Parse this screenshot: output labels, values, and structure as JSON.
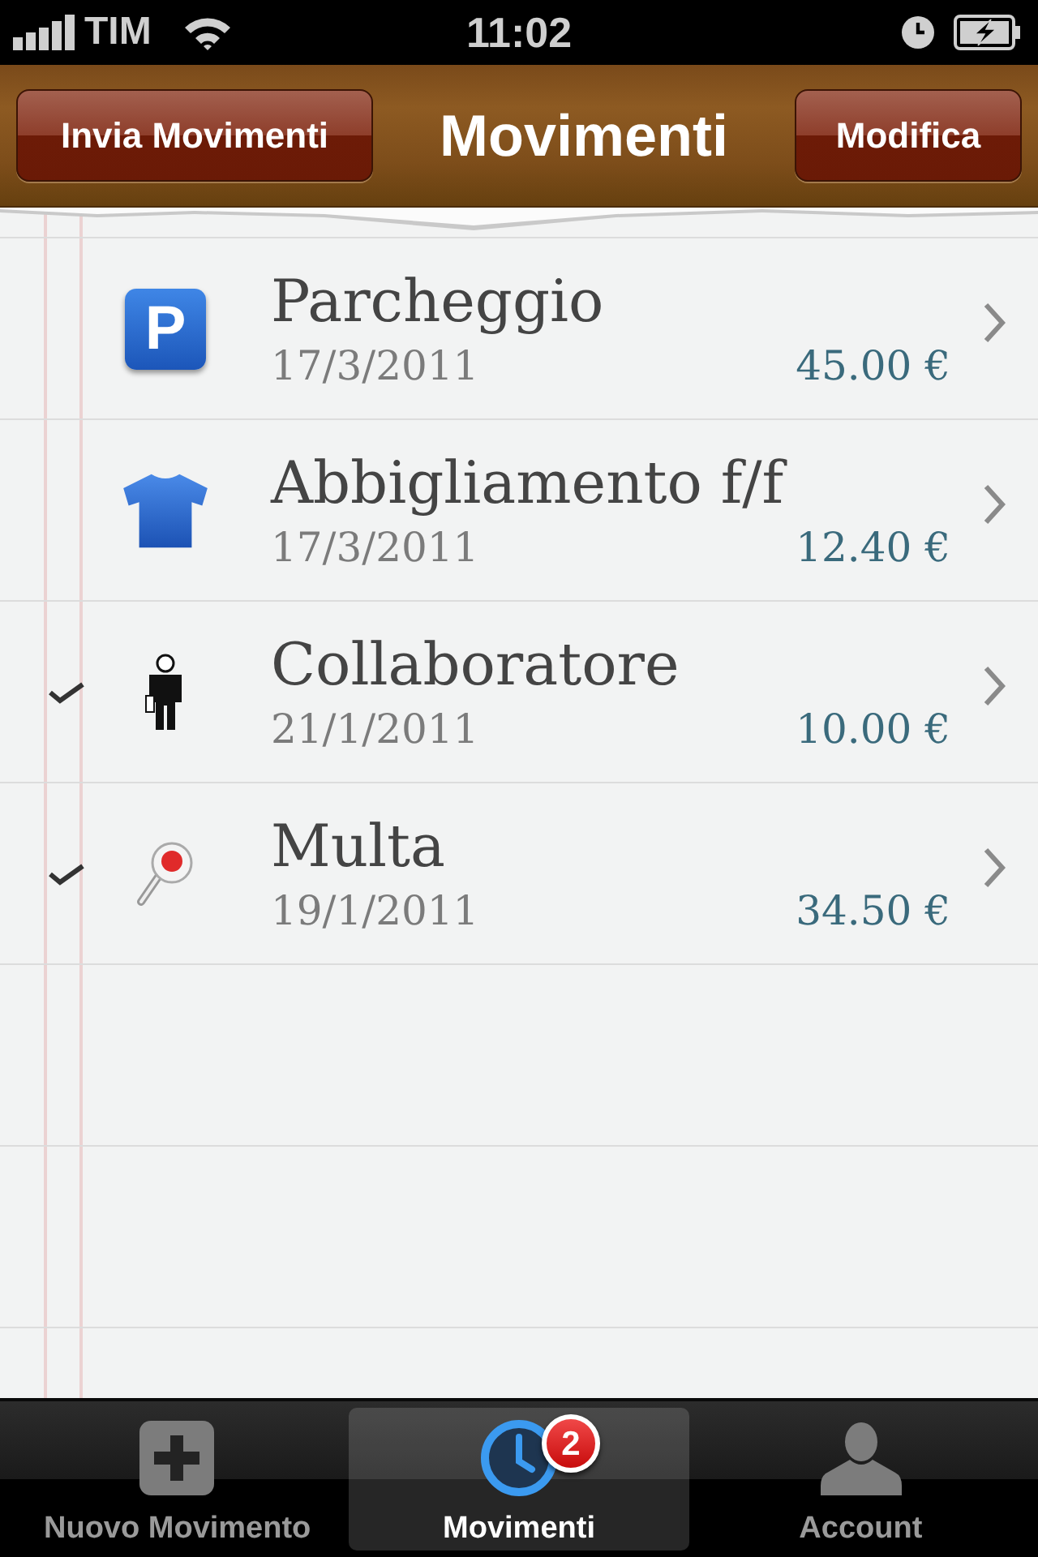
{
  "status_bar": {
    "carrier": "TIM",
    "time": "11:02"
  },
  "nav_bar": {
    "left_button": "Invia Movimenti",
    "title": "Movimenti",
    "right_button": "Modifica"
  },
  "movements": [
    {
      "kind": "parking",
      "icon_label": "P",
      "title": "Parcheggio",
      "date": "17/3/2011",
      "amount": "45.00 €",
      "checked": false
    },
    {
      "kind": "shirt",
      "title": "Abbigliamento f/f",
      "date": "17/3/2011",
      "amount": "12.40 €",
      "checked": false
    },
    {
      "kind": "person",
      "title": "Collaboratore",
      "date": "21/1/2011",
      "amount": "10.00 €",
      "checked": true
    },
    {
      "kind": "paddle",
      "title": "Multa",
      "date": "19/1/2011",
      "amount": "34.50 €",
      "checked": true
    }
  ],
  "tab_bar": [
    {
      "kind": "add",
      "label": "Nuovo Movimento",
      "selected": false
    },
    {
      "kind": "clock",
      "label": "Movimenti",
      "selected": true,
      "badge": "2"
    },
    {
      "kind": "person",
      "label": "Account",
      "selected": false
    }
  ]
}
